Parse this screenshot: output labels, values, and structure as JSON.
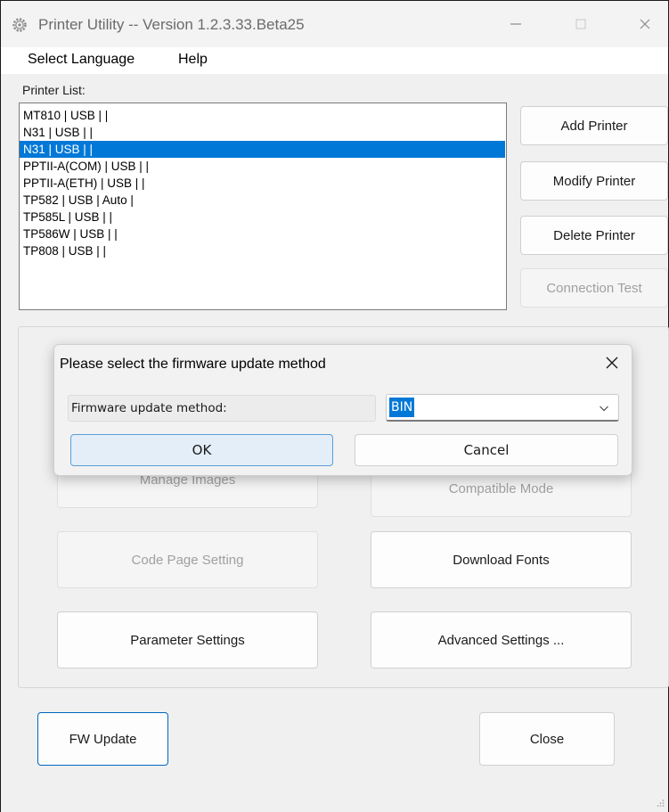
{
  "window": {
    "title": "Printer Utility -- Version 1.2.3.33.Beta25"
  },
  "menu": {
    "select_language": "Select Language",
    "help": "Help"
  },
  "printer_list": {
    "label": "Printer List:",
    "items": [
      "MT810 | USB |  |",
      "N31 | USB |  |",
      "N31 | USB |  |",
      "PPTII-A(COM) | USB |  |",
      "PPTII-A(ETH) | USB |  |",
      "TP582 | USB | Auto |",
      "TP585L | USB |  |",
      "TP586W | USB |  |",
      "TP808 | USB |  |"
    ],
    "selected_index": 2
  },
  "side_buttons": {
    "add": "Add Printer",
    "modify": "Modify Printer",
    "delete": "Delete Printer",
    "connection_test": "Connection Test"
  },
  "grid_buttons": {
    "manage_images": "Manage Images",
    "compatible_mode": "Compatible Mode",
    "code_page": "Code Page Setting",
    "download_fonts": "Download Fonts",
    "parameter_settings": "Parameter Settings",
    "advanced_settings": "Advanced Settings ..."
  },
  "bottom_buttons": {
    "fw_update": "FW Update",
    "close": "Close"
  },
  "dialog": {
    "title": "Please select the firmware update method",
    "field_label": "Firmware update method:",
    "selected_value": "BIN",
    "ok": "OK",
    "cancel": "Cancel"
  },
  "colors": {
    "selection": "#0078d7",
    "focus_border": "#0067c0",
    "disabled_text": "#a0a0a0"
  }
}
